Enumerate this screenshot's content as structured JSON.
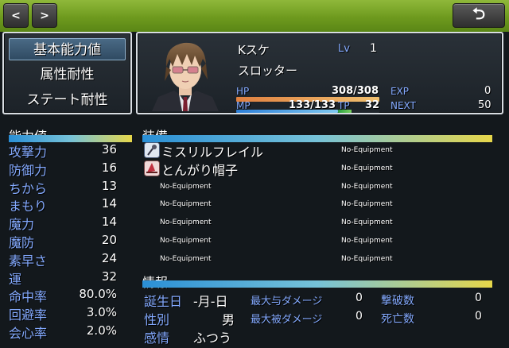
{
  "colors": {
    "system_text": "#84aaff",
    "hp_gauge": [
      "#e08040",
      "#f0c070"
    ],
    "mp_gauge": [
      "#2d7fd8",
      "#7fc8f0"
    ],
    "tp_gauge": [
      "#28a040",
      "#7ad060"
    ],
    "top_bar": "#7aa827"
  },
  "nav": {
    "prev": "<",
    "next": ">",
    "back": "⮌"
  },
  "menu": {
    "items": [
      {
        "label": "基本能力値",
        "selected": true
      },
      {
        "label": "属性耐性",
        "selected": false
      },
      {
        "label": "ステート耐性",
        "selected": false
      }
    ]
  },
  "actor": {
    "name": "Kスケ",
    "lv_label": "Lv",
    "lv": "1",
    "class": "スロッター",
    "hp_label": "HP",
    "hp": "308/308",
    "hp_rate": 1.0,
    "mp_label": "MP",
    "mp": "133/133",
    "mp_rate": 1.0,
    "tp_label": "TP",
    "tp": "32",
    "tp_rate": 0.32,
    "exp_label": "EXP",
    "exp": "0",
    "next_label": "NEXT",
    "next": "50"
  },
  "params": {
    "header": "能力値",
    "rows": [
      {
        "label": "攻撃力",
        "value": "36"
      },
      {
        "label": "防御力",
        "value": "16"
      },
      {
        "label": "ちから",
        "value": "13"
      },
      {
        "label": "まもり",
        "value": "14"
      },
      {
        "label": "魔力",
        "value": "14"
      },
      {
        "label": "魔防",
        "value": "20"
      },
      {
        "label": "素早さ",
        "value": "24"
      },
      {
        "label": "運",
        "value": "32"
      },
      {
        "label": "命中率",
        "value": "80.0%"
      },
      {
        "label": "回避率",
        "value": "3.0%"
      },
      {
        "label": "会心率",
        "value": "2.0%"
      }
    ]
  },
  "equip": {
    "header": "装備",
    "left": [
      {
        "name": "ミスリルフレイル",
        "icon": "flail-icon"
      },
      {
        "name": "とんがり帽子",
        "icon": "hat-icon"
      },
      {
        "name": "No-Equipment",
        "icon": ""
      },
      {
        "name": "No-Equipment",
        "icon": ""
      },
      {
        "name": "No-Equipment",
        "icon": ""
      },
      {
        "name": "No-Equipment",
        "icon": ""
      },
      {
        "name": "No-Equipment",
        "icon": ""
      }
    ],
    "right": [
      "No-Equipment",
      "No-Equipment",
      "No-Equipment",
      "No-Equipment",
      "No-Equipment",
      "No-Equipment",
      "No-Equipment"
    ]
  },
  "info": {
    "header": "情報",
    "birthday_label": "誕生日",
    "birthday": "-月-日",
    "gender_label": "性別",
    "gender": "男",
    "feeling_label": "感情",
    "feeling": "ふつう",
    "max_dealt_label": "最大与ダメージ",
    "max_dealt": "0",
    "max_taken_label": "最大被ダメージ",
    "max_taken": "0",
    "kills_label": "撃破数",
    "kills": "0",
    "deaths_label": "死亡数",
    "deaths": "0"
  }
}
